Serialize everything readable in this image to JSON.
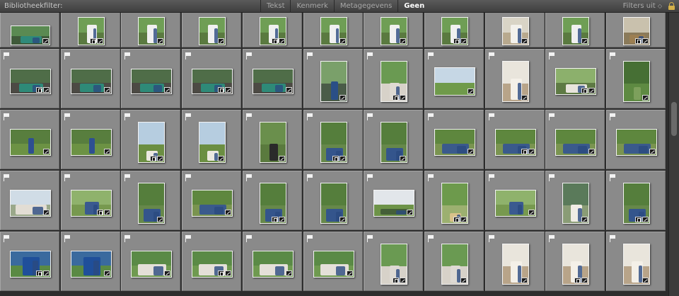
{
  "filter_bar": {
    "title": "Bibliotheekfilter:",
    "tabs": [
      {
        "label": "Tekst",
        "active": false
      },
      {
        "label": "Kenmerk",
        "active": false
      },
      {
        "label": "Metagegevens",
        "active": false
      },
      {
        "label": "Geen",
        "active": true
      }
    ],
    "filters_off_label": "Filters uit",
    "lock_icon": "lock-icon",
    "lock_color": "#d4b04a"
  },
  "grid": {
    "columns": 11,
    "rows": [
      {
        "start": 11,
        "photos": [
          "car-green",
          "couple-arch",
          "couple-arch",
          "couple-arch",
          "couple-arch",
          "couple-arch",
          "couple-arch",
          "couple-arch",
          "couple-portrait",
          "couple-arch",
          "sign-wood"
        ]
      },
      {
        "start": 22,
        "photos": [
          "car-green-l",
          "car-green-l",
          "car-green-l",
          "car-green-l",
          "car-green-l",
          "car-man-p",
          "guests-p",
          "field-l",
          "couple-p",
          "guests-l",
          "trees-p"
        ]
      },
      {
        "start": 33,
        "photos": [
          "groom-l",
          "groom-l",
          "chairs-p",
          "chairs-p",
          "speech-p",
          "seated-p",
          "seated-p",
          "seated-l",
          "seated-l",
          "seated-l",
          "seated-l"
        ]
      },
      {
        "start": 44,
        "photos": [
          "crowd-l",
          "couple-l",
          "seated-p",
          "seated-l",
          "seated-p",
          "seated-p",
          "field-wide",
          "bales-p",
          "couple-l",
          "bride-p",
          "seated-p"
        ]
      },
      {
        "start": 55,
        "photos": [
          "mask-l",
          "mask-l",
          "group-l",
          "group-l",
          "group-l",
          "group-l",
          "guests-p",
          "guests-p",
          "couple-p",
          "couple-p",
          "couple-p"
        ]
      }
    ]
  },
  "colors": {
    "cell_bg": "#8a8a8a",
    "grid_bg": "#2d2d2d",
    "active_tab": "#ffffff"
  }
}
